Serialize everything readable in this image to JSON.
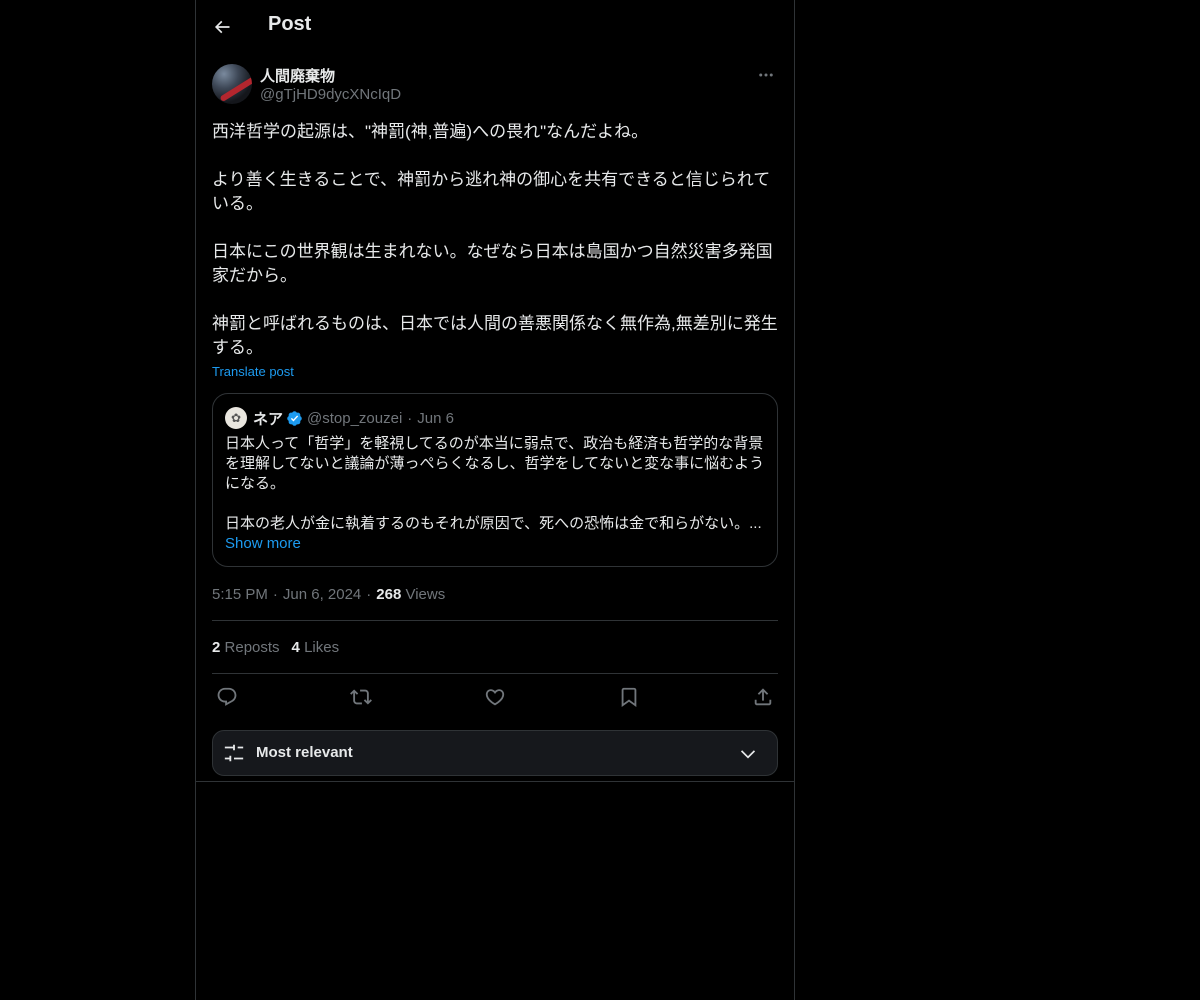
{
  "header": {
    "title": "Post"
  },
  "post": {
    "display_name": "人間廃棄物",
    "handle": "@gTjHD9dycXNcIqD",
    "paragraphs": [
      "西洋哲学の起源は、\"神罰(神,普遍)への畏れ\"なんだよね。",
      "より善く生きることで、神罰から逃れ神の御心を共有できると信じられている。",
      "日本にこの世界観は生まれない。なぜなら日本は島国かつ自然災害多発国家だから。",
      "神罰と呼ばれるものは、日本では人間の善悪関係なく無作為,無差別に発生する。"
    ],
    "translate_label": "Translate post",
    "time": "5:15 PM",
    "date": "Jun 6, 2024",
    "views_count": "268",
    "views_label": "Views",
    "reposts_count": "2",
    "reposts_label": "Reposts",
    "likes_count": "4",
    "likes_label": "Likes"
  },
  "quote": {
    "display_name": "ネア",
    "handle": "@stop_zouzei",
    "date": "Jun 6",
    "paragraphs": [
      "日本人って「哲学」を軽視してるのが本当に弱点で、政治も経済も哲学的な背景を理解してないと議論が薄っぺらくなるし、哲学をしてないと変な事に悩むようになる。",
      "日本の老人が金に執着するのもそれが原因で、死への恐怖は金で和らがない。..."
    ],
    "show_more_label": "Show more"
  },
  "sort": {
    "label": "Most relevant"
  },
  "colors": {
    "background": "#000000",
    "text": "#e7e9ea",
    "secondary": "#71767b",
    "accent": "#1d9bf0",
    "border": "#2f3336"
  },
  "icons": {
    "back": "arrow-left-icon",
    "more": "more-horizontal-icon",
    "verified": "verified-badge-icon",
    "reply": "reply-icon",
    "repost": "repost-icon",
    "like": "heart-icon",
    "bookmark": "bookmark-icon",
    "share": "share-icon",
    "sort": "sliders-icon",
    "chevron": "chevron-down-icon"
  }
}
